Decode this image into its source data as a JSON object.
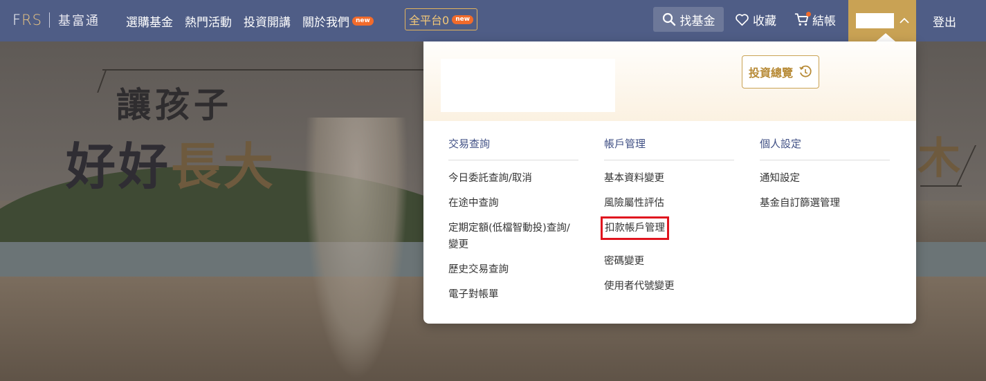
{
  "nav": {
    "logo": {
      "frs_f": "F",
      "frs_rs": "RS",
      "chinese": "基富通"
    },
    "menu": [
      {
        "label": "選購基金",
        "badge": ""
      },
      {
        "label": "熱門活動",
        "badge": ""
      },
      {
        "label": "投資開講",
        "badge": ""
      },
      {
        "label": "關於我們",
        "badge": "new"
      }
    ],
    "platform": {
      "label": "全平台0",
      "badge": "new"
    },
    "search_label": "找基金",
    "favorites_label": "收藏",
    "checkout_label": "結帳",
    "logout_label": "登出"
  },
  "hero": {
    "line1": "讓孩子",
    "line2_a": "好好",
    "line2_b": "長大",
    "right_char": "木"
  },
  "panel": {
    "overview_label": "投資總覽",
    "columns": [
      {
        "title": "交易查詢",
        "links": [
          "今日委託查詢/取消",
          "在途中查詢",
          "定期定額(低檔智動投)查詢/變更",
          "歷史交易查詢",
          "電子對帳單"
        ]
      },
      {
        "title": "帳戶管理",
        "links": [
          "基本資料變更",
          "風險屬性評估",
          "扣款帳戶管理",
          "密碼變更",
          "使用者代號變更"
        ]
      },
      {
        "title": "個人設定",
        "links": [
          "通知設定",
          "基金自訂篩選管理"
        ]
      }
    ]
  },
  "colors": {
    "nav_bg": "#4f5d86",
    "accent_gold": "#c9a254",
    "badge_orange": "#f26b2b",
    "highlight_red": "#e0141e"
  },
  "icons": [
    "search-icon",
    "heart-icon",
    "cart-icon",
    "chevron-up-icon",
    "history-icon"
  ]
}
